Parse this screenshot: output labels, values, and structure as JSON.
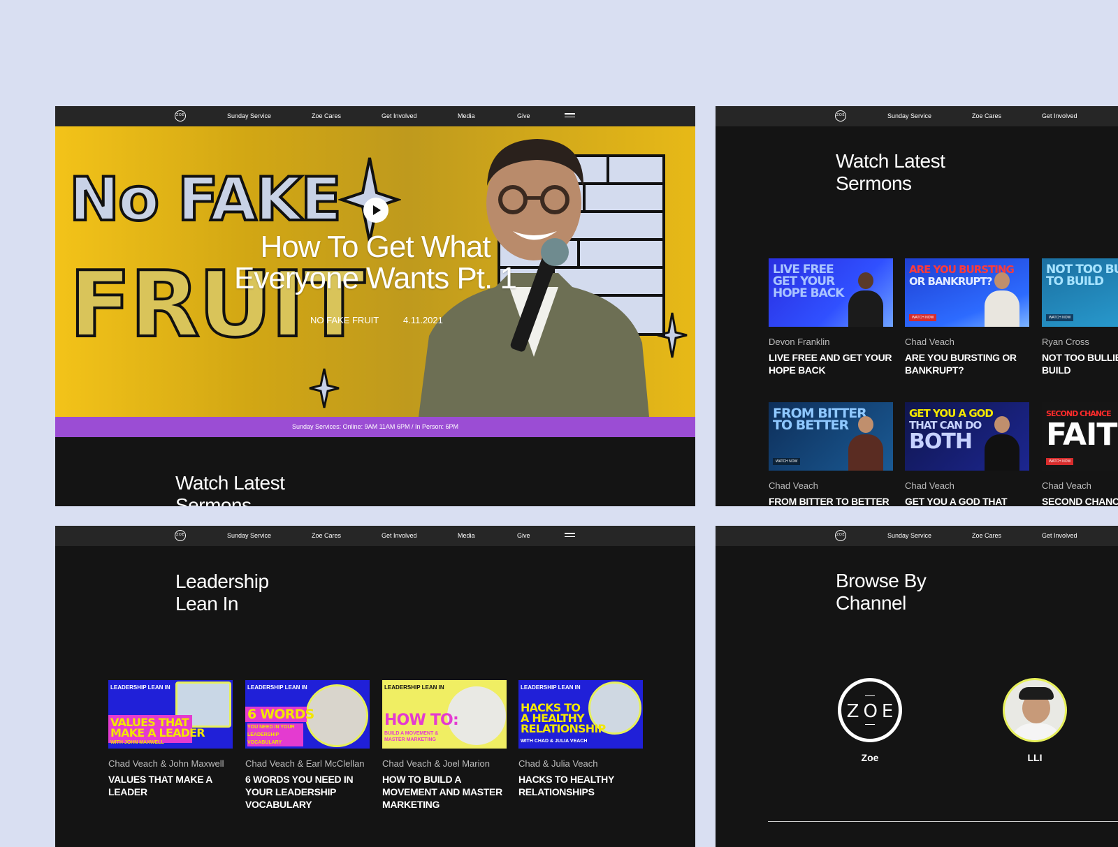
{
  "nav": {
    "logo": "ZOE",
    "items": [
      "Sunday Service",
      "Zoe Cares",
      "Get Involved",
      "Media",
      "Give"
    ]
  },
  "hero": {
    "art_text": [
      "No FAKE",
      "FRUIT"
    ],
    "title_line1": "How To Get What",
    "title_line2": "Everyone Wants Pt. 1",
    "series": "NO FAKE FRUIT",
    "date": "4.11.2021",
    "banner": "Sunday Services: Online: 9AM 11AM 6PM / In Person: 6PM"
  },
  "sections": {
    "watch_latest_1": "Watch Latest",
    "watch_latest_2": "Sermons",
    "leadership_1": "Leadership",
    "leadership_2": "Lean In",
    "browse_1": "Browse By",
    "browse_2": "Channel"
  },
  "sermons": [
    {
      "speaker": "Devon Franklin",
      "title": "LIVE FREE AND GET YOUR HOPE BACK",
      "thumb": [
        "LIVE FREE",
        "GET YOUR",
        "HOPE BACK"
      ],
      "bg": "#2c2fd6",
      "accent": "#a9c4ff"
    },
    {
      "speaker": "Chad Veach",
      "title": "ARE YOU BURSTING OR BANKRUPT?",
      "thumb": [
        "ARE YOU BURSTING",
        "OR BANKRUPT?"
      ],
      "bg": "#1f3fd1",
      "accent": "#ff3a3a",
      "watch": "WATCH NOW"
    },
    {
      "speaker": "Ryan Cross",
      "title": "NOT TOO BULLIED TO BUILD",
      "thumb": [
        "NOT TOO BULLIED",
        "TO BUILD"
      ],
      "bg": "#1b7aa8",
      "accent": "#a6e3ff",
      "watch": "WATCH NOW"
    },
    {
      "speaker": "Chad Veach",
      "title": "FROM BITTER TO BETTER",
      "thumb": [
        "FROM BITTER",
        "TO BETTER"
      ],
      "bg": "#0f3f73",
      "accent": "#8fc8ff",
      "watch": "WATCH NOW"
    },
    {
      "speaker": "Chad Veach",
      "title": "GET YOU A GOD THAT CAN",
      "thumb": [
        "GET YOU A GOD",
        "THAT CAN DO",
        "BOTH"
      ],
      "bg": "#141a6e",
      "accent": "#f2e600"
    },
    {
      "speaker": "Chad Veach",
      "title": "SECOND CHANCE FAITH",
      "thumb": [
        "SECOND CHANCE",
        "FAITH"
      ],
      "bg": "#1a1a1a",
      "accent": "#ff2b2b",
      "watch": "WATCH NOW"
    }
  ],
  "leadership": [
    {
      "speaker": "Chad Veach & John Maxwell",
      "title": "VALUES THAT MAKE A LEADER",
      "thumb_top": "LEADERSHIP LEAN IN",
      "thumb_big": [
        "VALUES THAT",
        "MAKE A LEADER"
      ],
      "thumb_sub": "WITH JOHN MAXWELL",
      "bg": "#2020d8",
      "big_color": "#f2e600",
      "big_bg": "#e43bd0"
    },
    {
      "speaker": "Chad Veach & Earl McClellan",
      "title": "6 WORDS YOU NEED IN YOUR LEADERSHIP VOCABULARY",
      "thumb_top": "LEADERSHIP LEAN IN",
      "thumb_big": [
        "6 WORDS"
      ],
      "thumb_sub": "YOU NEED IN YOUR LEADERSHIP VOCABULARY",
      "bg": "#2020d8",
      "big_color": "#f2e600",
      "big_bg": "#e43bd0"
    },
    {
      "speaker": "Chad Veach & Joel Marion",
      "title": "HOW TO BUILD A MOVEMENT AND MASTER MARKETING",
      "thumb_top": "LEADERSHIP LEAN IN",
      "thumb_big": [
        "HOW TO:"
      ],
      "thumb_sub": "BUILD A MOVEMENT & MASTER MARKETING",
      "bg": "#f0ee63",
      "big_color": "#e43bd0",
      "big_bg": "transparent"
    },
    {
      "speaker": "Chad & Julia Veach",
      "title": "HACKS TO HEALTHY RELATIONSHIPS",
      "thumb_top": "LEADERSHIP LEAN IN",
      "thumb_big": [
        "HACKS TO",
        "A HEALTHY",
        "RELATIONSHIP"
      ],
      "thumb_sub": "WITH CHAD & JULIA VEACH",
      "bg": "#2020d8",
      "big_color": "#f2e600",
      "big_bg": "transparent"
    }
  ],
  "channels": [
    {
      "name": "Zoe",
      "logo": "ZOE"
    },
    {
      "name": "LLI"
    }
  ],
  "colors": {
    "page_bg": "#d9dff2",
    "panel_bg": "#141414",
    "nav_bg": "#262626",
    "banner_bg": "#9b4dd4"
  }
}
